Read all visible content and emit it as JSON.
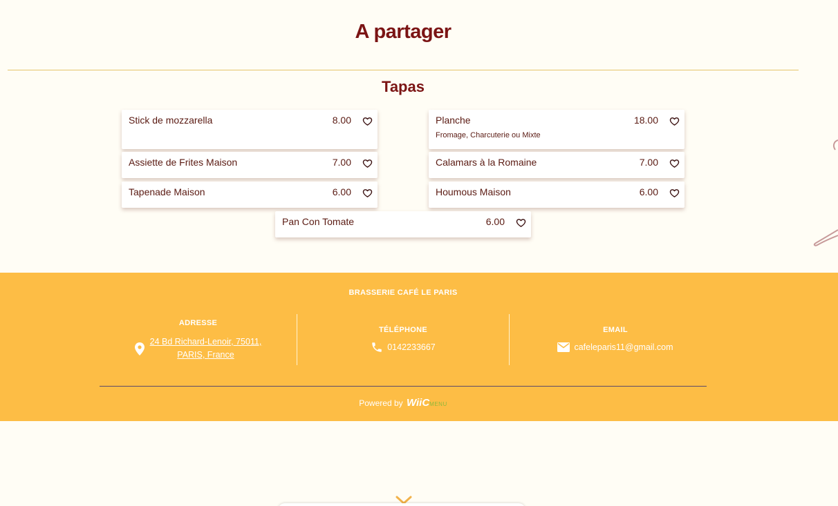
{
  "page": {
    "title": "A partager",
    "section_title": "Tapas"
  },
  "items": [
    {
      "name": "Stick de mozzarella",
      "price": "8.00",
      "desc": ""
    },
    {
      "name": "Planche",
      "price": "18.00",
      "desc": "Fromage, Charcuterie ou Mixte"
    },
    {
      "name": "Assiette de Frites Maison",
      "price": "7.00",
      "desc": ""
    },
    {
      "name": "Calamars à la Romaine",
      "price": "7.00",
      "desc": ""
    },
    {
      "name": "Tapenade Maison",
      "price": "6.00",
      "desc": ""
    },
    {
      "name": "Houmous Maison",
      "price": "6.00",
      "desc": ""
    },
    {
      "name": "Pan Con Tomate",
      "price": "6.00",
      "desc": ""
    }
  ],
  "footer": {
    "brand": "BRASSERIE CAFÉ LE PARIS",
    "address_label": "ADRESSE",
    "address_line1": "24 Bd Richard-Lenoir, 75011,",
    "address_line2": "PARIS, France",
    "phone_label": "TÉLÉPHONE",
    "phone": "0142233667",
    "email_label": "EMAIL",
    "email": "cafeleparis11@gmail.com",
    "powered_by": "Powered by",
    "logo_text": "WiiC",
    "logo_sub": "MENU"
  },
  "colors": {
    "accent": "#7b1414",
    "footer_bg": "#fdbd45",
    "background": "#fffdf5"
  },
  "icons": {
    "favorite": "heart-outline-icon",
    "address": "map-pin-icon",
    "phone": "phone-icon",
    "email": "envelope-icon",
    "scroll": "chevron-down-icon"
  }
}
